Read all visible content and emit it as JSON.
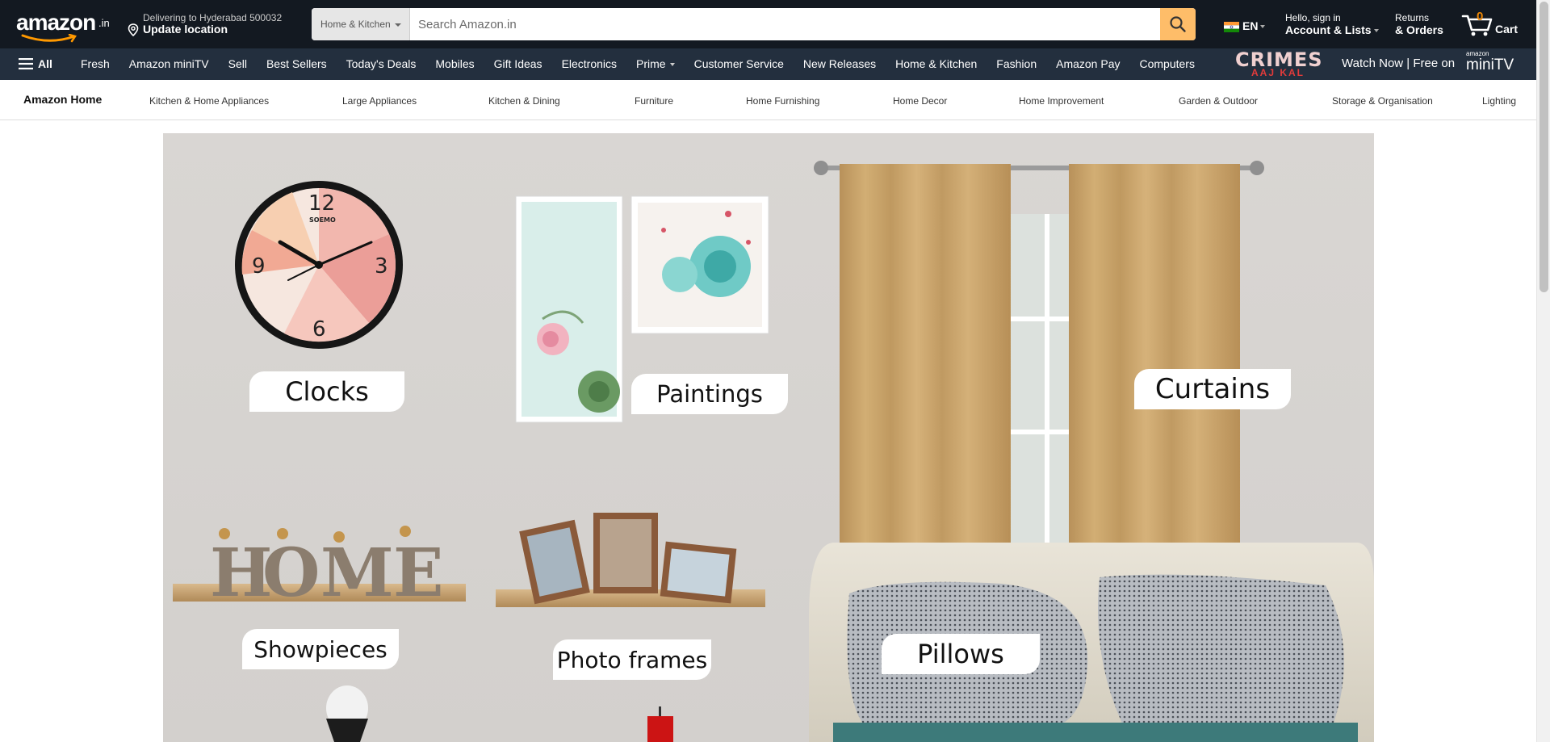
{
  "header": {
    "logo": "amazon",
    "logo_suffix": ".in",
    "deliver_line1": "Delivering to Hyderabad 500032",
    "deliver_line2": "Update location",
    "search_category": "Home & Kitchen",
    "search_placeholder": "Search Amazon.in",
    "language": "EN",
    "account_line1": "Hello, sign in",
    "account_line2": "Account & Lists",
    "returns_line1": "Returns",
    "returns_line2": "& Orders",
    "cart_count": "0",
    "cart_label": "Cart"
  },
  "nav": {
    "all_label": "All",
    "items": [
      "Fresh",
      "Amazon miniTV",
      "Sell",
      "Best Sellers",
      "Today's Deals",
      "Mobiles",
      "Gift Ideas",
      "Electronics",
      "Prime",
      "Customer Service",
      "New Releases",
      "Home & Kitchen",
      "Fashion",
      "Amazon Pay",
      "Computers"
    ],
    "promo_title": "CRIMES",
    "promo_subtitle": "AAJ KAL",
    "promo_text": "Watch Now | Free on",
    "promo_brand_small": "amazon",
    "promo_brand": "miniTV"
  },
  "subnav": {
    "title": "Amazon Home",
    "items": [
      "Kitchen & Home Appliances",
      "Large Appliances",
      "Kitchen & Dining",
      "Furniture",
      "Home Furnishing",
      "Home Decor",
      "Home Improvement",
      "Garden & Outdoor",
      "Storage & Organisation",
      "Lighting"
    ]
  },
  "hero": {
    "clock_brand": "SOEMO",
    "clock_numbers": [
      "12",
      "3",
      "6",
      "9"
    ],
    "tags": {
      "clocks": "Clocks",
      "paintings": "Paintings",
      "curtains": "Curtains",
      "showpieces": "Showpieces",
      "photo_frames": "Photo frames",
      "pillows": "Pillows"
    },
    "home_letters": [
      "H",
      "O",
      "M",
      "E"
    ]
  },
  "colors": {
    "topbar": "#131921",
    "navbar": "#232f3e",
    "search_button": "#febd69",
    "cart_count": "#f08804",
    "hero_wall": "#d6d3d0",
    "curtain": "#c9a46a"
  }
}
